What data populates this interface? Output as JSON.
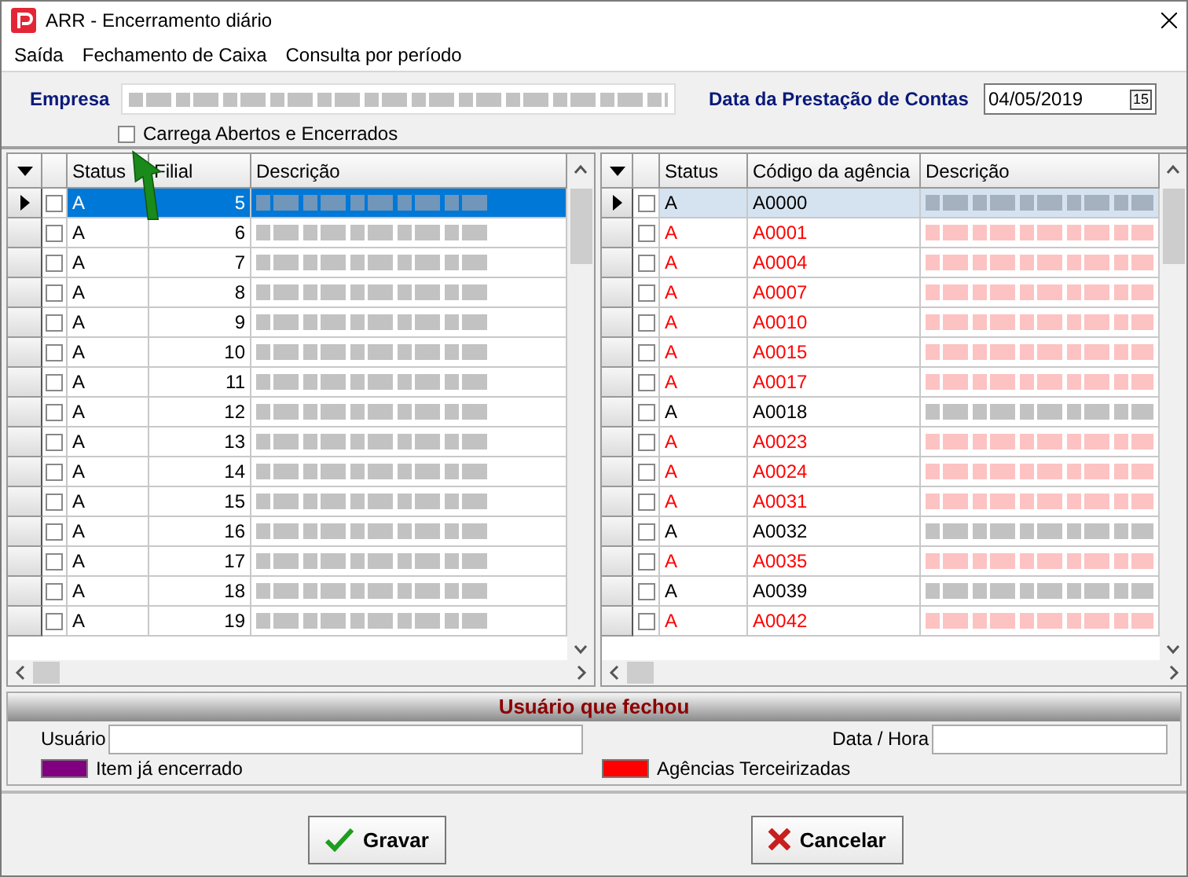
{
  "window": {
    "title": "ARR - Encerramento diário"
  },
  "menu": [
    {
      "label": "Saída"
    },
    {
      "label": "Fechamento de Caixa"
    },
    {
      "label": "Consulta por período"
    }
  ],
  "filters": {
    "company_label": "Empresa",
    "date_label": "Data da Prestação de Contas",
    "date_value": "04/05/2019",
    "calendar_button": "15",
    "load_all": {
      "label": "Carrega Abertos e Encerrados",
      "checked": false
    }
  },
  "left_grid": {
    "columns": [
      "Status",
      "Filial",
      "Descrição"
    ],
    "rows": [
      {
        "status": "A",
        "filial": "5",
        "checked": false,
        "selected": true
      },
      {
        "status": "A",
        "filial": "6",
        "checked": false,
        "selected": false
      },
      {
        "status": "A",
        "filial": "7",
        "checked": false,
        "selected": false
      },
      {
        "status": "A",
        "filial": "8",
        "checked": false,
        "selected": false
      },
      {
        "status": "A",
        "filial": "9",
        "checked": false,
        "selected": false
      },
      {
        "status": "A",
        "filial": "10",
        "checked": false,
        "selected": false
      },
      {
        "status": "A",
        "filial": "11",
        "checked": false,
        "selected": false
      },
      {
        "status": "A",
        "filial": "12",
        "checked": false,
        "selected": false
      },
      {
        "status": "A",
        "filial": "13",
        "checked": false,
        "selected": false
      },
      {
        "status": "A",
        "filial": "14",
        "checked": false,
        "selected": false
      },
      {
        "status": "A",
        "filial": "15",
        "checked": false,
        "selected": false
      },
      {
        "status": "A",
        "filial": "16",
        "checked": false,
        "selected": false
      },
      {
        "status": "A",
        "filial": "17",
        "checked": false,
        "selected": false
      },
      {
        "status": "A",
        "filial": "18",
        "checked": false,
        "selected": false
      },
      {
        "status": "A",
        "filial": "19",
        "checked": false,
        "selected": false
      }
    ]
  },
  "right_grid": {
    "columns": [
      "Status",
      "Código da agência",
      "Descrição"
    ],
    "rows": [
      {
        "status": "A",
        "code": "A0000",
        "checked": false,
        "selected": true,
        "color": "#000000"
      },
      {
        "status": "A",
        "code": "A0001",
        "checked": false,
        "selected": false,
        "color": "#ff0000"
      },
      {
        "status": "A",
        "code": "A0004",
        "checked": false,
        "selected": false,
        "color": "#ff0000"
      },
      {
        "status": "A",
        "code": "A0007",
        "checked": false,
        "selected": false,
        "color": "#ff0000"
      },
      {
        "status": "A",
        "code": "A0010",
        "checked": false,
        "selected": false,
        "color": "#ff0000"
      },
      {
        "status": "A",
        "code": "A0015",
        "checked": false,
        "selected": false,
        "color": "#ff0000"
      },
      {
        "status": "A",
        "code": "A0017",
        "checked": false,
        "selected": false,
        "color": "#ff0000"
      },
      {
        "status": "A",
        "code": "A0018",
        "checked": false,
        "selected": false,
        "color": "#000000"
      },
      {
        "status": "A",
        "code": "A0023",
        "checked": false,
        "selected": false,
        "color": "#ff0000"
      },
      {
        "status": "A",
        "code": "A0024",
        "checked": false,
        "selected": false,
        "color": "#ff0000"
      },
      {
        "status": "A",
        "code": "A0031",
        "checked": false,
        "selected": false,
        "color": "#ff0000"
      },
      {
        "status": "A",
        "code": "A0032",
        "checked": false,
        "selected": false,
        "color": "#000000"
      },
      {
        "status": "A",
        "code": "A0035",
        "checked": false,
        "selected": false,
        "color": "#ff0000"
      },
      {
        "status": "A",
        "code": "A0039",
        "checked": false,
        "selected": false,
        "color": "#000000"
      },
      {
        "status": "A",
        "code": "A0042",
        "checked": false,
        "selected": false,
        "color": "#ff0000"
      }
    ]
  },
  "closed_by": {
    "title": "Usuário que fechou",
    "user_label": "Usuário",
    "datetime_label": "Data / Hora"
  },
  "legend": [
    {
      "label": "Item já encerrado",
      "color": "#800080"
    },
    {
      "label": "Agências Terceirizadas",
      "color": "#ff0000"
    }
  ],
  "buttons": [
    {
      "label": "Gravar",
      "kind": "save"
    },
    {
      "label": "Cancelar",
      "kind": "cancel"
    }
  ]
}
